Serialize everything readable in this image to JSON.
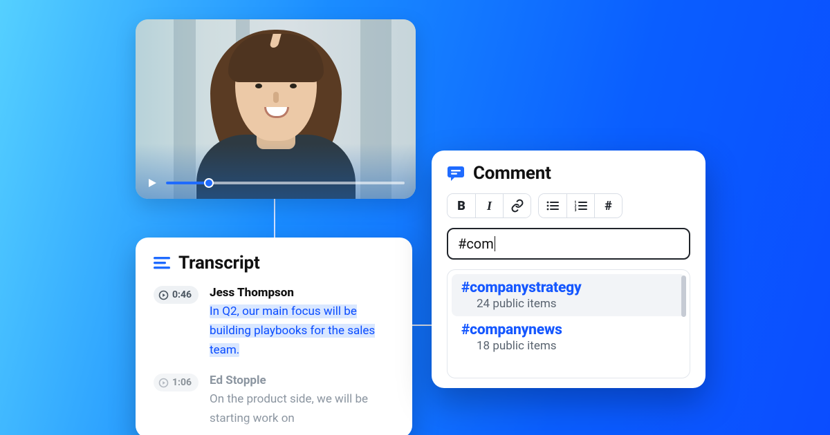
{
  "video": {
    "progress_pct": 18
  },
  "transcript": {
    "title": "Transcript",
    "entries": [
      {
        "timestamp": "0:46",
        "speaker": "Jess Thompson",
        "text": "In Q2, our main focus will be building playbooks for the sales team.",
        "highlighted": true
      },
      {
        "timestamp": "1:06",
        "speaker": "Ed Stopple",
        "text": "On the product side, we will be starting work on",
        "highlighted": false
      }
    ]
  },
  "comment": {
    "title": "Comment",
    "input_value": "#com",
    "suggestions": [
      {
        "tag": "#companystrategy",
        "meta": "24 public items"
      },
      {
        "tag": "#companynews",
        "meta": "18 public items"
      }
    ]
  },
  "colors": {
    "accent": "#1f6bff",
    "highlight_bg": "#d9e7ff",
    "highlight_fg": "#0a4cff"
  }
}
